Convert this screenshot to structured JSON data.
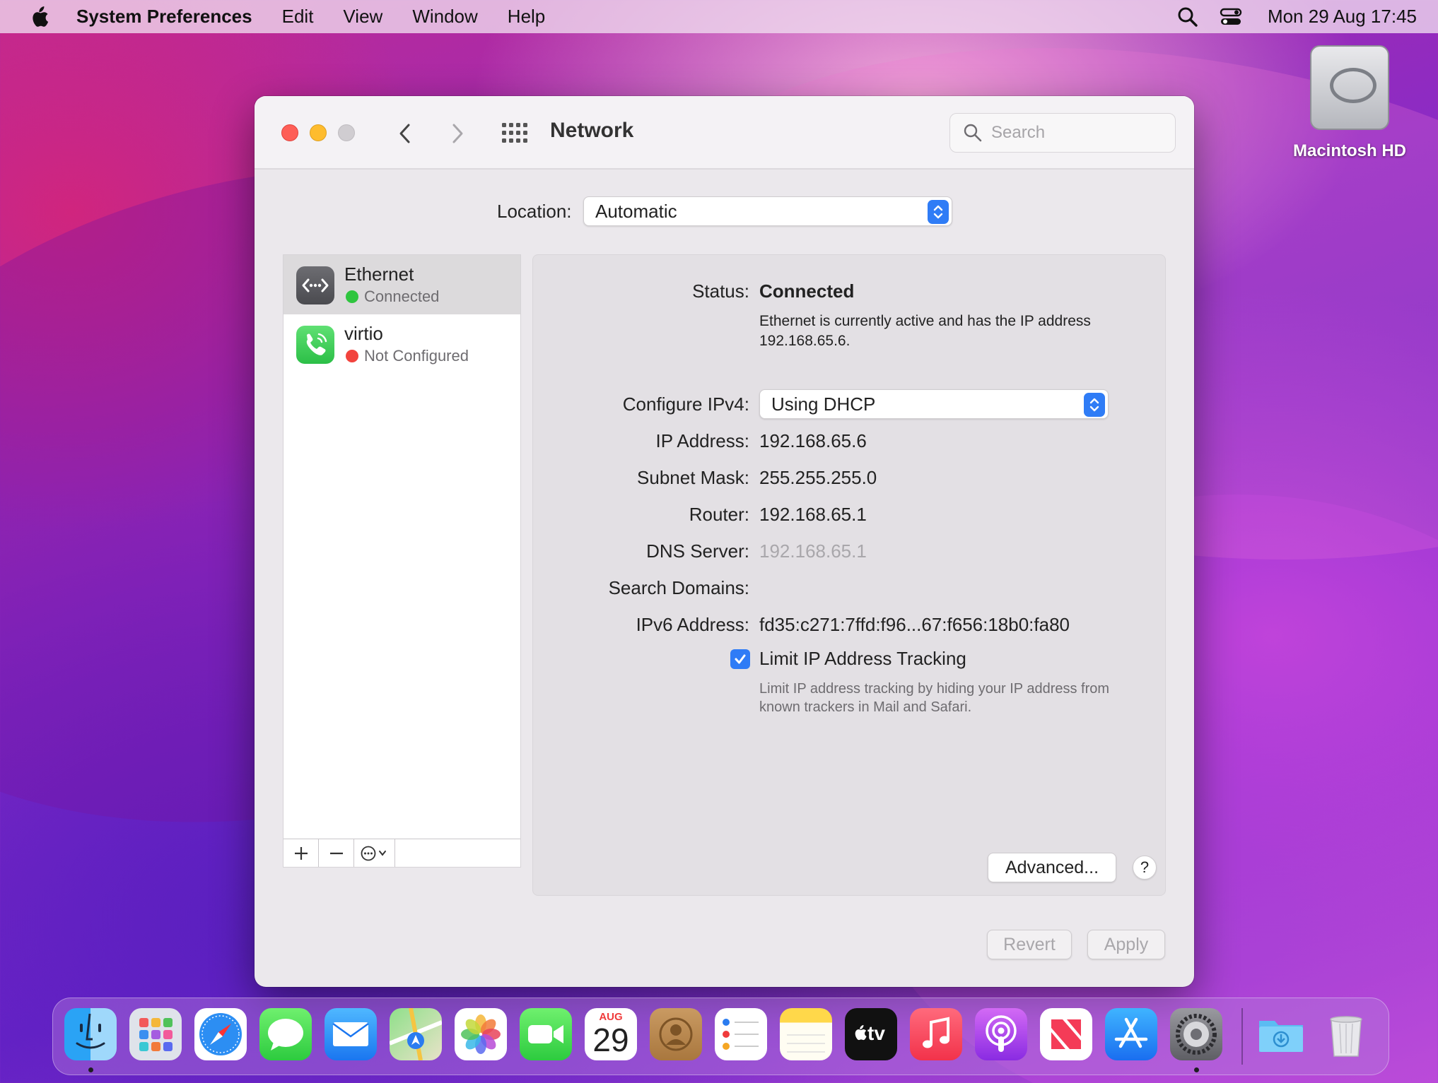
{
  "menubar": {
    "app_name": "System Preferences",
    "items": [
      "Edit",
      "View",
      "Window",
      "Help"
    ],
    "clock": "Mon 29 Aug  17:45"
  },
  "desktop": {
    "drive_label": "Macintosh HD"
  },
  "window": {
    "title": "Network",
    "search_placeholder": "Search",
    "location_label": "Location:",
    "location_value": "Automatic",
    "services": [
      {
        "name": "Ethernet",
        "status": "Connected",
        "status_color": "#2fc53f",
        "icon": "ethernet-icon"
      },
      {
        "name": "virtio",
        "status": "Not Configured",
        "status_color": "#f2433d",
        "icon": "phone-modem-icon"
      }
    ],
    "detail": {
      "status_label": "Status:",
      "status_value": "Connected",
      "status_desc": "Ethernet is currently active and has the IP address 192.168.65.6.",
      "configure_label": "Configure IPv4:",
      "configure_value": "Using DHCP",
      "ip_label": "IP Address:",
      "ip_value": "192.168.65.6",
      "subnet_label": "Subnet Mask:",
      "subnet_value": "255.255.255.0",
      "router_label": "Router:",
      "router_value": "192.168.65.1",
      "dns_label": "DNS Server:",
      "dns_value": "192.168.65.1",
      "search_domains_label": "Search Domains:",
      "ipv6_label": "IPv6 Address:",
      "ipv6_value": "fd35:c271:7ffd:f96...67:f656:18b0:fa80",
      "limit_tracking_label": "Limit IP Address Tracking",
      "limit_tracking_checked": true,
      "limit_tracking_desc": "Limit IP address tracking by hiding your IP address from known trackers in Mail and Safari.",
      "advanced_label": "Advanced...",
      "help_label": "?"
    },
    "revert_label": "Revert",
    "apply_label": "Apply",
    "accent_color": "#2f7cf6"
  },
  "dock": {
    "calendar_month": "AUG",
    "calendar_day": "29",
    "tv_label": "tv",
    "apps": [
      "finder",
      "launchpad",
      "safari",
      "messages",
      "mail",
      "maps",
      "photos",
      "facetime",
      "calendar",
      "contacts",
      "reminders",
      "notes",
      "apple-tv",
      "music",
      "podcasts",
      "news",
      "app-store",
      "system-preferences",
      "downloads",
      "trash"
    ]
  }
}
